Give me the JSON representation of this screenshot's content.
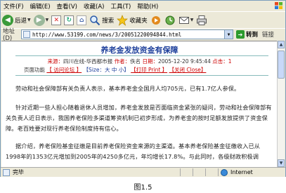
{
  "menu": [
    "文件(F)",
    "编辑(E)",
    "查看(V)",
    "收藏(A)",
    "工具(T)",
    "帮助(H)"
  ],
  "toolbar": {
    "back_label": "后退",
    "search_label": "搜索",
    "favorites_label": "收藏夹"
  },
  "address": {
    "label": "地址(D)",
    "url": "http://www.53199.com/news/3/20051220094844.html",
    "go_label": "转到",
    "links_label": "链接"
  },
  "article": {
    "title": "养老金发放资金有保障",
    "meta_source_label": "来源：",
    "meta_source": "四川在线-华西都市报",
    "meta_author_label": "作者：",
    "meta_author": "佚名",
    "meta_date_label": "日期：",
    "meta_date": "2005-12-20 9:45:44",
    "meta_clicks_label": "点击：",
    "meta_clicks": "1",
    "tools_label": "页面功能",
    "tool_forum": "【 访问论坛 】",
    "tool_size": "【Size：大 中 小】",
    "tool_print": "【打印 Print 】",
    "tool_close": "【关闭 Close】",
    "p1": "劳动和社会保障部有关负责人表示，基本养老金全国月人均705元，已有1.7亿人参保。",
    "p2": "针对近期一些人担心随着退休人员增加，养老金发放是否面临资金紧张的疑问，劳动和社会保障部有关负责人近日表示，我国养老保险多渠道筹资机制已初步形成，为养老金的按时足额发放提供了资金保障。老百姓要对现行养老保险制度持有信心。",
    "p3": "据介绍，养老保险基金征缴是目前养老保险资金来源的主渠道。基本养老保险基金征缴收入已从1998年的1353亿元增加到2005年的4250多亿元，年均增长17.8%。与此同时，各级财政积极调"
  },
  "status": {
    "text": "完毕",
    "zone": "Internet"
  },
  "caption": "图1.5"
}
